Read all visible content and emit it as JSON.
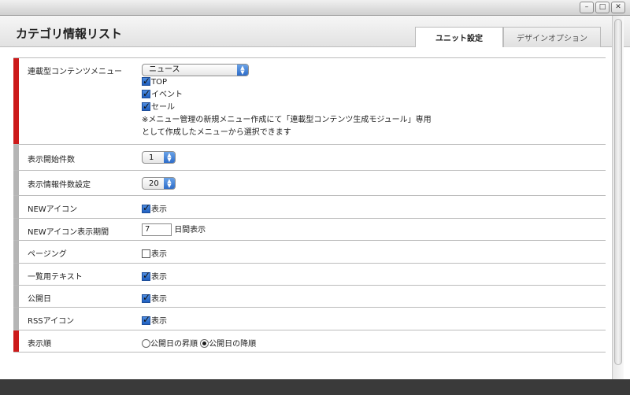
{
  "window": {
    "title": ""
  },
  "header": {
    "title": "カテゴリ情報リスト",
    "tabs": [
      {
        "label": "ユニット設定",
        "active": true
      },
      {
        "label": "デザインオプション",
        "active": false
      }
    ]
  },
  "rows": {
    "serial_menu": {
      "label": "連載型コンテンツメニュー",
      "selected": "ニュース",
      "options": [
        {
          "label": "TOP",
          "checked": true
        },
        {
          "label": "イベント",
          "checked": true
        },
        {
          "label": "セール",
          "checked": true
        }
      ],
      "note_line1": "※メニュー管理の新規メニュー作成にて「連載型コンテンツ生成モジュール」専用",
      "note_line2": "として作成したメニューから選択できます"
    },
    "start_count": {
      "label": "表示開始件数",
      "selected": "1"
    },
    "count_setting": {
      "label": "表示情報件数設定",
      "selected": "20"
    },
    "new_icon": {
      "label": "NEWアイコン",
      "checkbox_label": "表示",
      "checked": true
    },
    "new_icon_period": {
      "label": "NEWアイコン表示期間",
      "value": "7",
      "unit": "日間表示"
    },
    "paging": {
      "label": "ページング",
      "checkbox_label": "表示",
      "checked": false
    },
    "list_text": {
      "label": "一覧用テキスト",
      "checkbox_label": "表示",
      "checked": true
    },
    "pub_date": {
      "label": "公開日",
      "checkbox_label": "表示",
      "checked": true
    },
    "rss_icon": {
      "label": "RSSアイコン",
      "checkbox_label": "表示",
      "checked": true
    },
    "order": {
      "label": "表示順",
      "asc_label": "公開日の昇順",
      "desc_label": "公開日の降順",
      "selected": "desc"
    }
  },
  "colors": {
    "required_bar": "#cc1a1a",
    "optional_bar": "#b5b5b5"
  }
}
